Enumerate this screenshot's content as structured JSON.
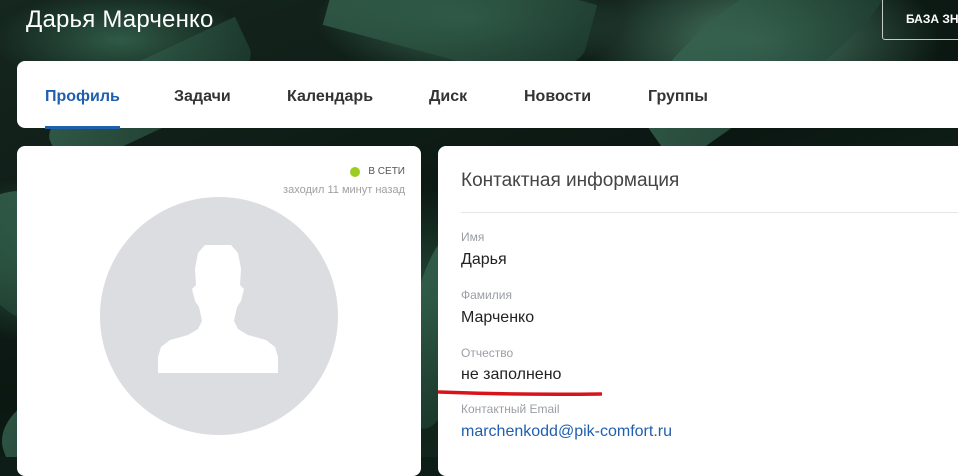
{
  "header": {
    "title": "Дарья Марченко",
    "kb_button_label": "БАЗА ЗН"
  },
  "nav": {
    "tabs": [
      {
        "label": "Профиль",
        "active": true
      },
      {
        "label": "Задачи",
        "active": false
      },
      {
        "label": "Календарь",
        "active": false
      },
      {
        "label": "Диск",
        "active": false
      },
      {
        "label": "Новости",
        "active": false
      },
      {
        "label": "Группы",
        "active": false
      }
    ],
    "accent_color": "#1f5fae"
  },
  "profile": {
    "status": "В СЕТИ",
    "status_color": "#9acd1f",
    "last_seen": "заходил 11 минут назад",
    "avatar_icon": "user-silhouette-icon"
  },
  "contact": {
    "title": "Контактная информация",
    "fields": [
      {
        "label": "Имя",
        "value": "Дарья"
      },
      {
        "label": "Фамилия",
        "value": "Марченко"
      },
      {
        "label": "Отчество",
        "value": "не заполнено"
      },
      {
        "label": "Контактный Email",
        "value": "marchenkodd@pik-comfort.ru"
      }
    ]
  }
}
